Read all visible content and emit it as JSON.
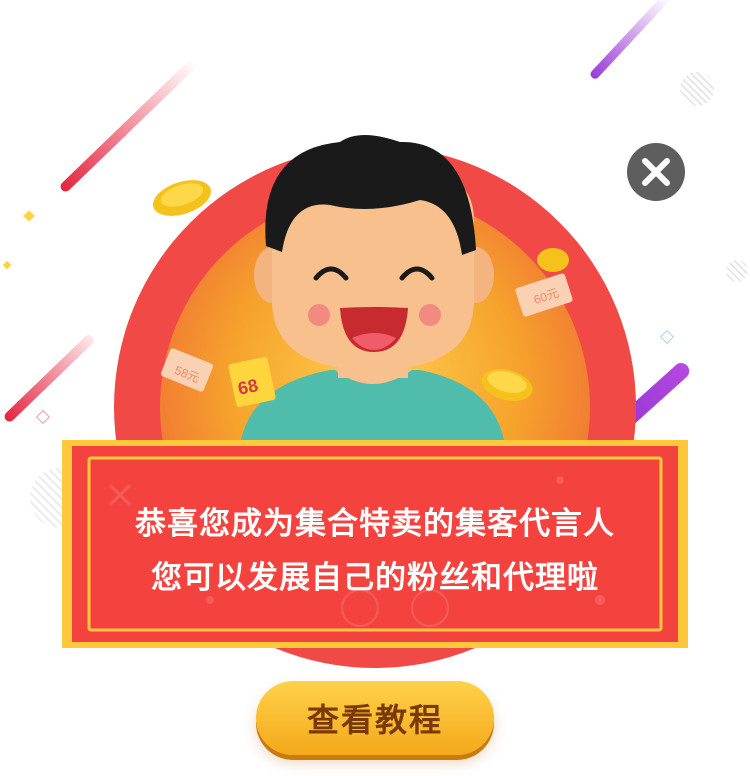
{
  "dialog": {
    "close_icon": "close-icon",
    "message_line1": "恭喜您成为集合特卖的集客代言人",
    "message_line2": "您可以发展自己的粉丝和代理啦",
    "cta_label": "查看教程"
  },
  "decorations": {
    "coupon_left_text": "58元",
    "coupon_right_text": "60元",
    "coupon_center_text": "68"
  },
  "colors": {
    "banner_red": "#f4433f",
    "banner_border": "#ffc83a",
    "circle_red": "#f14a46",
    "glow_orange": "#f6a32c",
    "shirt_teal": "#4fbcac",
    "button_yellow": "#f9b52b"
  }
}
